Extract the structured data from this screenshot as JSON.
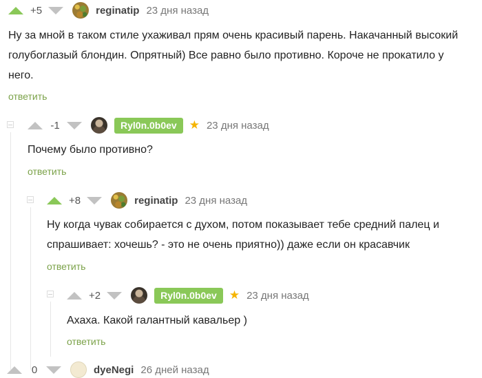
{
  "comments": [
    {
      "rating": "+5",
      "user": "reginatip",
      "user_badge": false,
      "starred": false,
      "time": "23 дня назад",
      "text": "Ну за мной в таком стиле ухаживал прям очень красивый парень. Накачанный высокий голубоглазый блондин. Опрятный) Все равно было противно. Короче не прокатило у него.",
      "reply": "ответить"
    },
    {
      "rating": "-1",
      "user": "Ryl0n.0b0ev",
      "user_badge": true,
      "starred": true,
      "time": "23 дня назад",
      "text": "Почему было противно?",
      "reply": "ответить"
    },
    {
      "rating": "+8",
      "user": "reginatip",
      "user_badge": false,
      "starred": false,
      "time": "23 дня назад",
      "text": "Ну когда чувак собирается с духом, потом показывает тебе средний палец и спрашивает: хочешь? - это не очень приятно)) даже если он красавчик",
      "reply": "ответить"
    },
    {
      "rating": "+2",
      "user": "Ryl0n.0b0ev",
      "user_badge": true,
      "starred": true,
      "time": "23 дня назад",
      "text": "Ахаха. Какой галантный кавальер )",
      "reply": "ответить"
    },
    {
      "rating": "0",
      "user": "dyeNegi",
      "user_badge": false,
      "starred": false,
      "time": "26 дней назад",
      "text": "",
      "reply": ""
    }
  ],
  "icons": {
    "upvote": "upvote-arrow-icon",
    "downvote": "downvote-arrow-icon",
    "star": "star-icon",
    "collapse": "collapse-thread-icon"
  },
  "colors": {
    "accent_green": "#8ac858",
    "reply_link": "#7ba249",
    "star": "#f5b400"
  }
}
